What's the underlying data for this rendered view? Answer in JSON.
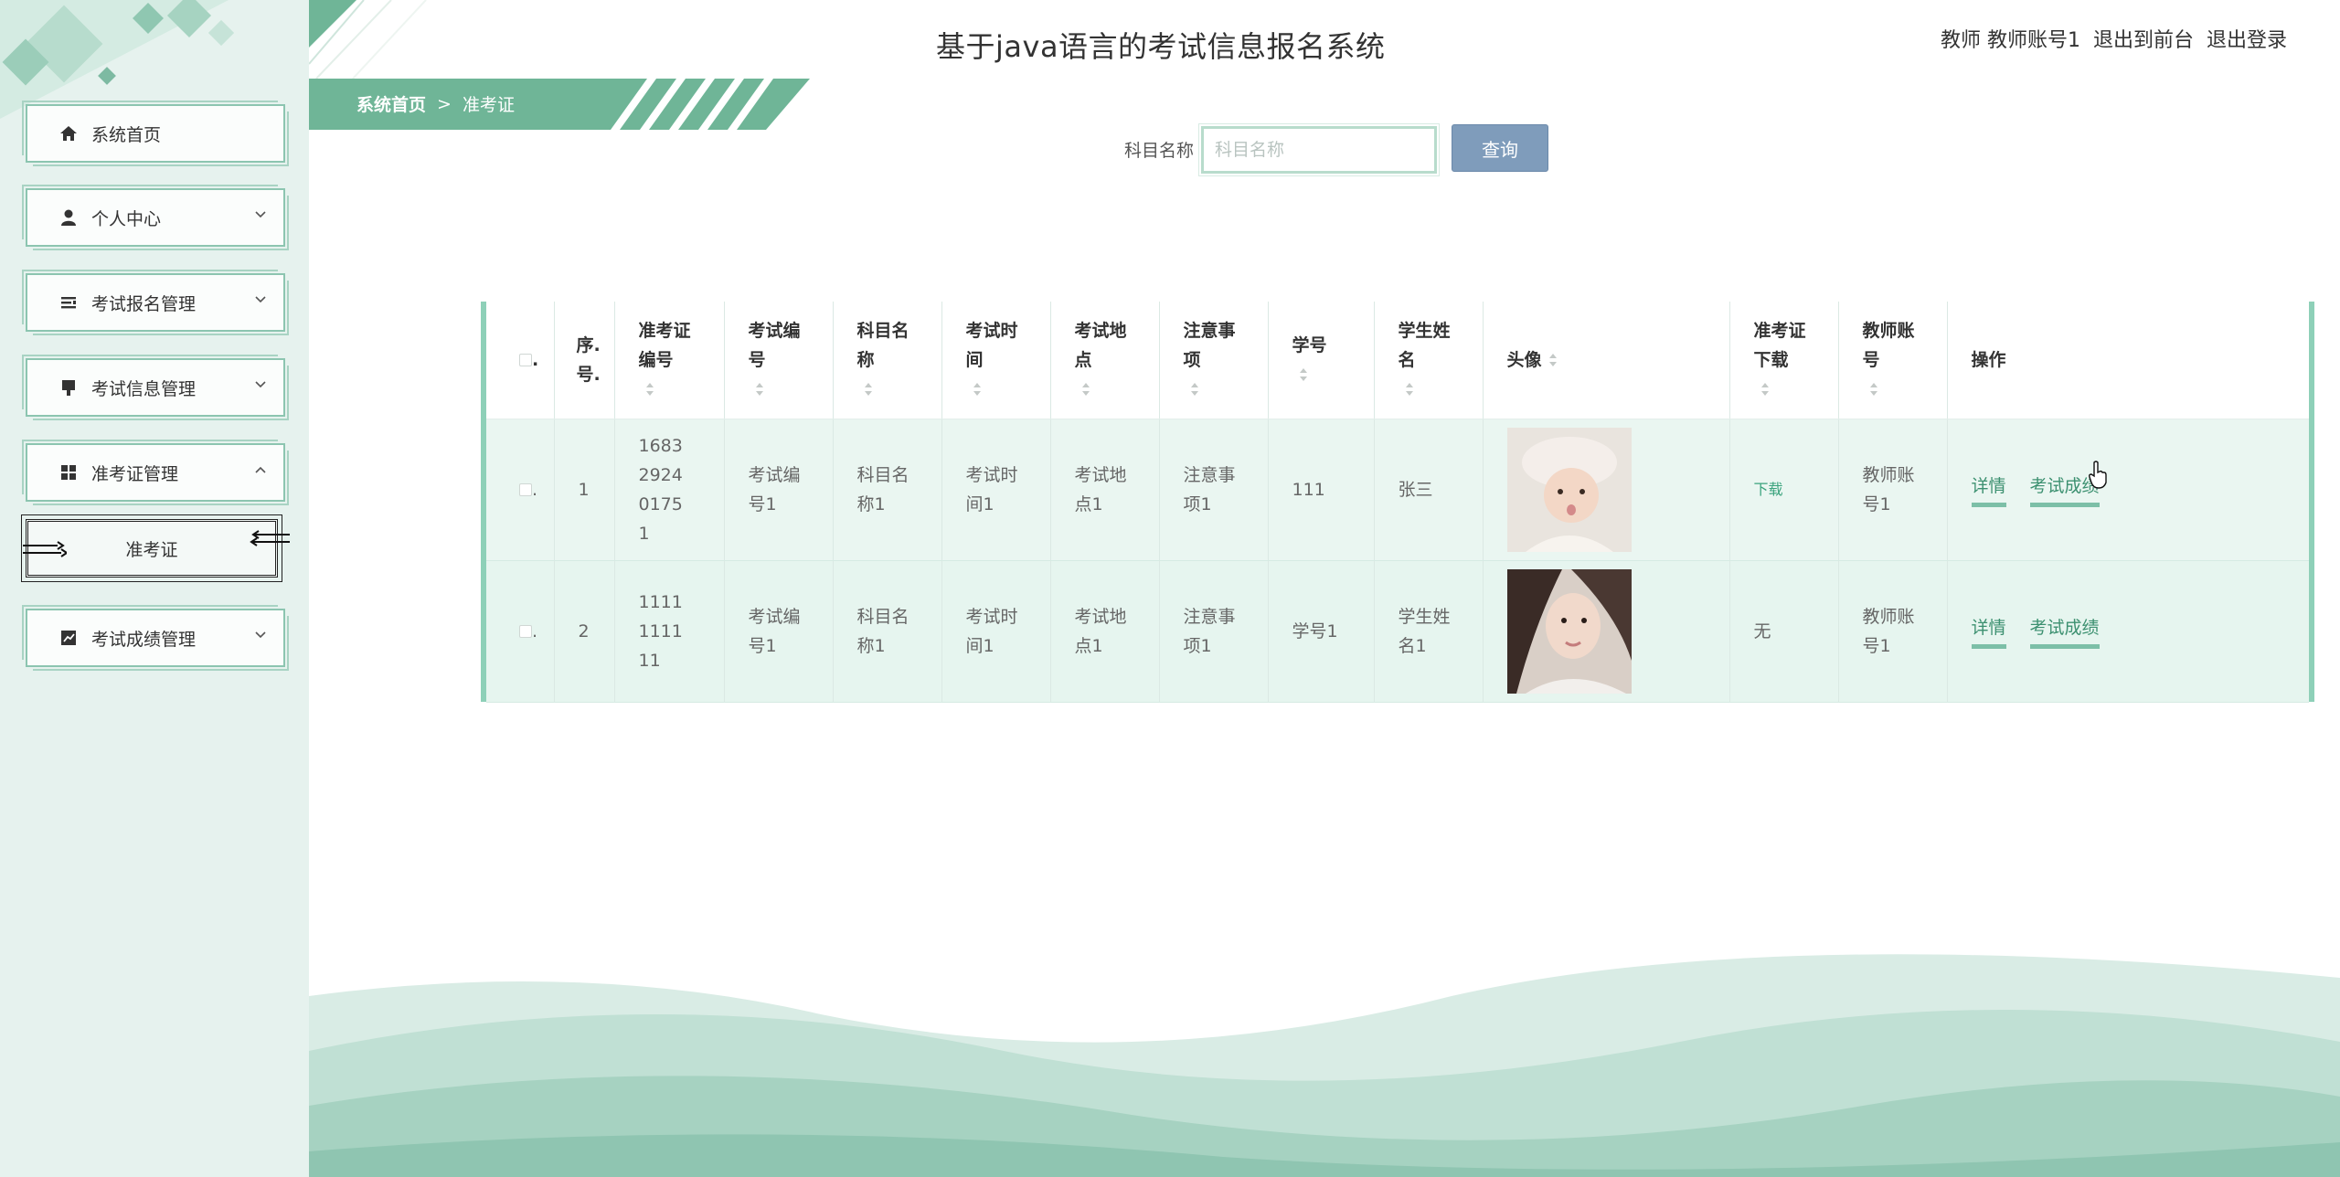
{
  "app": {
    "title": "基于java语言的考试信息报名系统"
  },
  "user": {
    "role_and_name": "教师 教师账号1",
    "to_front_label": "退出到前台",
    "logout_label": "退出登录"
  },
  "sidebar": {
    "items": [
      {
        "label": "系统首页",
        "icon": "home-icon"
      },
      {
        "label": "个人中心",
        "icon": "person-icon"
      },
      {
        "label": "考试报名管理",
        "icon": "list-icon"
      },
      {
        "label": "考试信息管理",
        "icon": "stamp-icon"
      },
      {
        "label": "准考证管理",
        "icon": "grid-icon"
      },
      {
        "label": "考试成绩管理",
        "icon": "chart-icon"
      }
    ],
    "submenu": {
      "label": "准考证"
    }
  },
  "breadcrumb": {
    "home": "系统首页",
    "separator": ">",
    "current": "准考证"
  },
  "search": {
    "label": "科目名称",
    "placeholder": "科目名称",
    "value": "",
    "button_label": "查询"
  },
  "table": {
    "headers": {
      "checkbox": ".",
      "index": "序.号.",
      "ticket_no": "准考证编号",
      "exam_no": "考试编号",
      "subject": "科目名称",
      "exam_time": "考试时间",
      "exam_place": "考试地点",
      "notes": "注意事项",
      "student_no": "学号",
      "student_name": "学生姓名",
      "avatar": "头像",
      "ticket_download": "准考证下载",
      "teacher_account": "教师账号",
      "actions": "操作"
    },
    "rows": [
      {
        "checkbox": ".",
        "index": "1",
        "ticket_no": "1683292401751",
        "exam_no": "考试编号1",
        "subject": "科目名称1",
        "exam_time": "考试时间1",
        "exam_place": "考试地点1",
        "notes": "注意事项1",
        "student_no": "111",
        "student_name": "张三",
        "download": "下载",
        "teacher_account": "教师账号1",
        "detail_label": "详情",
        "score_label": "考试成绩"
      },
      {
        "checkbox": ".",
        "index": "2",
        "ticket_no": "1111111111",
        "exam_no": "考试编号1",
        "subject": "科目名称1",
        "exam_time": "考试时间1",
        "exam_place": "考试地点1",
        "notes": "注意事项1",
        "student_no": "学号1",
        "student_name": "学生姓名1",
        "download": "无",
        "teacher_account": "教师账号1",
        "detail_label": "详情",
        "score_label": "考试成绩"
      }
    ]
  },
  "colors": {
    "accent": "#8ed0b8",
    "sidebar_bg": "#e6f2ee",
    "banner": "#6fb597",
    "search_button": "#7f9cbb"
  }
}
